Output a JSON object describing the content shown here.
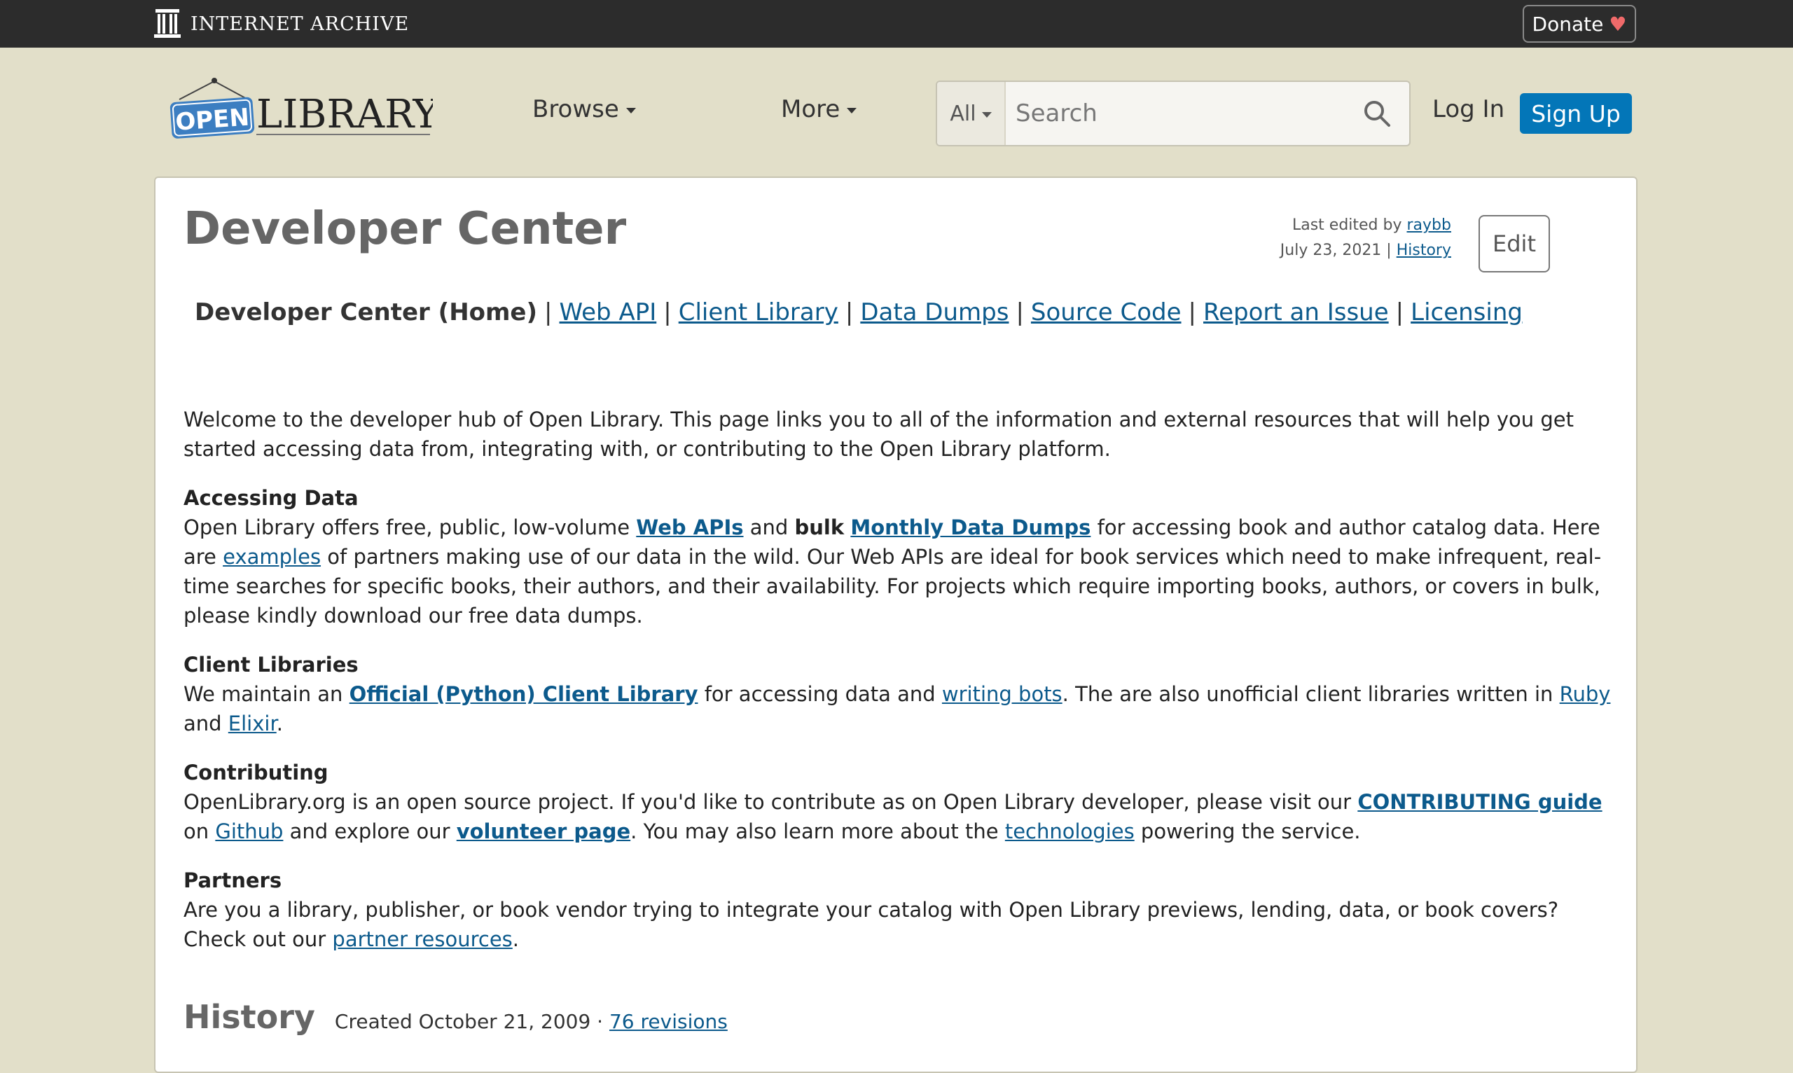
{
  "ia_bar": {
    "title": "INTERNET ARCHIVE",
    "donate_label": "Donate",
    "donate_heart": "♥"
  },
  "header": {
    "logo_open": "OPEN",
    "logo_library": "LIBRARY",
    "browse_label": "Browse",
    "more_label": "More",
    "search_scope": "All",
    "search_placeholder": "Search",
    "login_label": "Log In",
    "signup_label": "Sign Up"
  },
  "page": {
    "title": "Developer Center",
    "last_edited_prefix": "Last edited by",
    "last_edited_user": "raybb",
    "last_edited_date": "July 23, 2021",
    "history_link": "History",
    "edit_label": "Edit"
  },
  "devnav": {
    "current": "Developer Center (Home)",
    "links": [
      "Web API",
      "Client Library",
      "Data Dumps",
      "Source Code",
      "Report an Issue",
      "Licensing"
    ]
  },
  "content": {
    "intro": "Welcome to the developer hub of Open Library. This page links you to all of the information and external resources that will help you get started accessing data from, integrating with, or contributing to the Open Library platform.",
    "accessing": {
      "heading": "Accessing Data",
      "t1": "Open Library offers free, public, low-volume ",
      "l1": "Web APIs",
      "t2": " and ",
      "t2b": "bulk",
      "t2c": " ",
      "l2": "Monthly Data Dumps",
      "t3": " for accessing book and author catalog data. Here are ",
      "l3": "examples",
      "t4": " of partners making use of our data in the wild. Our Web APIs are ideal for book services which need to make infrequent, real-time searches for specific books, their authors, and their availability. For projects which require importing books, authors, or covers in bulk, please kindly download our free data dumps."
    },
    "clients": {
      "heading": "Client Libraries",
      "t1": "We maintain an ",
      "l1": "Official (Python) Client Library",
      "t2": " for accessing data and ",
      "l2": "writing bots",
      "t3": ". The are also unofficial client libraries written in ",
      "l3": "Ruby",
      "t4": " and ",
      "l4": "Elixir",
      "t5": "."
    },
    "contributing": {
      "heading": "Contributing",
      "t1": "OpenLibrary.org is an open source project. If you'd like to contribute as on Open Library developer, please visit our ",
      "l1": "CONTRIBUTING guide",
      "t2": " on ",
      "l2": "Github",
      "t3": " and explore our ",
      "l3": "volunteer page",
      "t4": ". You may also learn more about the ",
      "l4": "technologies",
      "t5": " powering the service."
    },
    "partners": {
      "heading": "Partners",
      "t1": "Are you a library, publisher, or book vendor trying to integrate your catalog with Open Library previews, lending, data, or book covers? Check out our ",
      "l1": "partner resources",
      "t2": "."
    }
  },
  "history": {
    "title": "History",
    "created": "Created October 21, 2009 · ",
    "revisions": "76 revisions"
  },
  "colors": {
    "background": "#e2dfc9",
    "ia_bar": "#2c2c2c",
    "link": "#0c5a8c",
    "signup": "#0376b8",
    "heart": "#f06a6a"
  }
}
